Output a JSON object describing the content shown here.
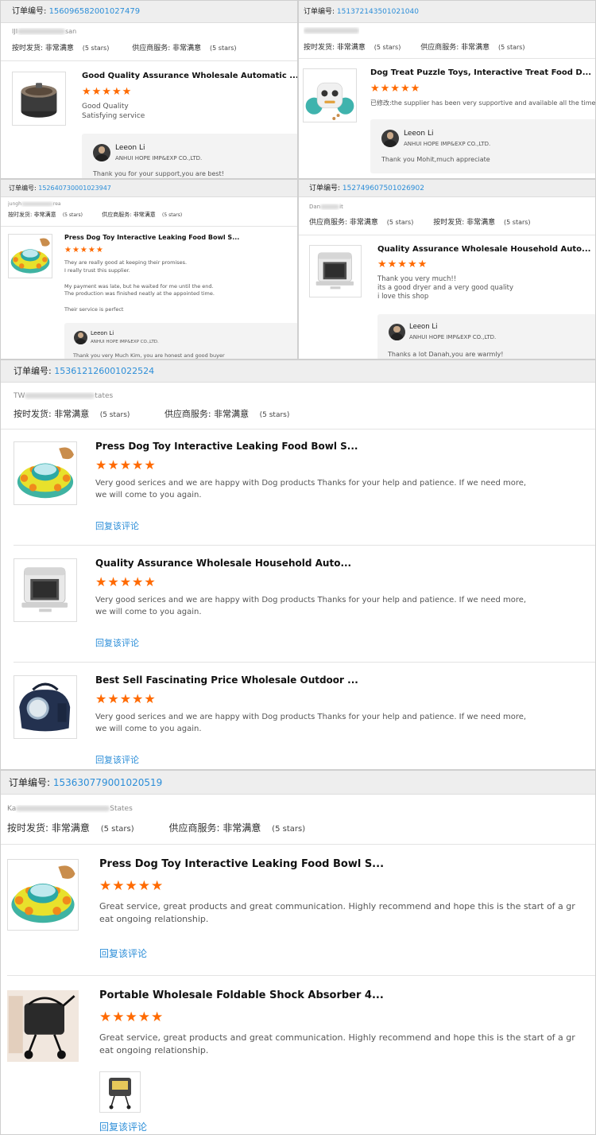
{
  "labels": {
    "order_prefix": "订单编号: ",
    "delivery": "按时发货: ",
    "supplier_service": "供应商服务: ",
    "very_satisfied": "非常满意",
    "five_stars": "(5 stars)",
    "reply_link": "回复该评论",
    "stars": "★★★★★"
  },
  "reviews": [
    {
      "order_number": "156096582001027479",
      "buyer_visible": "IJI",
      "buyer_tail": "san",
      "product_title": "Good Quality Assurance Wholesale Automatic ...",
      "comment": [
        "Good Quality",
        "Satisfying service"
      ],
      "reply": {
        "name": "Leeon Li",
        "company": "ANHUI HOPE IMP&EXP CO.,LTD.",
        "text": "Thank you for your support,you are best!"
      }
    },
    {
      "order_number": "151372143501021040",
      "buyer_visible": "",
      "buyer_tail": "",
      "product_title": "Dog Treat Puzzle Toys, Interactive Treat Food D...",
      "comment": [
        "已修改:the supplier has been very supportive and available all the time"
      ],
      "reply": {
        "name": "Leeon Li",
        "company": "ANHUI HOPE IMP&EXP CO.,LTD.",
        "text": "Thank you Mohit,much appreciate"
      }
    },
    {
      "order_number": "152640730001023947",
      "buyer_visible": "jungh",
      "buyer_tail": "rea",
      "product_title": "Press Dog Toy Interactive Leaking Food Bowl S...",
      "comment": [
        "They are really good at keeping their promises.",
        "I really trust this supplier.",
        "",
        "My payment was late, but he waited for me until the end.",
        "The production was finished neatly at the appointed time.",
        "",
        "Their service is perfect"
      ],
      "reply": {
        "name": "Leeon Li",
        "company": "ANHUI HOPE IMP&EXP CO.,LTD.",
        "text": "Thank you very Much  Kim, you are honest and good buyer"
      }
    },
    {
      "order_number": "152749607501026902",
      "buyer_visible": "Dan",
      "buyer_tail": "it",
      "product_title": "Quality Assurance Wholesale Household Auto...",
      "comment": [
        "Thank you very much!!",
        "its a good dryer and a very good quality",
        "i love this shop"
      ],
      "reply": {
        "name": "Leeon Li",
        "company": "ANHUI HOPE IMP&EXP CO.,LTD.",
        "text": "Thanks a lot  Danah,you are warmly!"
      }
    }
  ],
  "orders": [
    {
      "order_number": "153612126001022524",
      "buyer_visible": "TW",
      "buyer_tail": "tates",
      "items": [
        {
          "title": "Press Dog Toy Interactive Leaking Food Bowl S...",
          "comment": [
            "Very good serices and we are happy with Dog products  Thanks for your help and patience. If we need more,",
            "we will come to you again."
          ]
        },
        {
          "title": "Quality Assurance Wholesale Household Auto...",
          "comment": [
            "Very good serices and we are happy with Dog products  Thanks for your help and patience. If we need more,",
            "we will come to you again."
          ]
        },
        {
          "title": "Best Sell Fascinating Price Wholesale Outdoor ...",
          "comment": [
            "Very good serices and we are happy with Dog products  Thanks for your help and patience. If we need more,",
            "we will come to you again."
          ]
        }
      ]
    },
    {
      "order_number": "153630779001020519",
      "buyer_visible": "Ka",
      "buyer_tail": "States",
      "items": [
        {
          "title": "Press Dog Toy Interactive Leaking Food Bowl S...",
          "comment": [
            "Great service, great products and great communication. Highly recommend and hope this is the start of a gr",
            "eat ongoing relationship."
          ]
        },
        {
          "title": "Portable Wholesale Foldable Shock Absorber 4...",
          "comment": [
            "Great service, great products and great communication. Highly recommend and hope this is the start of a gr",
            "eat ongoing relationship."
          ]
        }
      ]
    }
  ]
}
